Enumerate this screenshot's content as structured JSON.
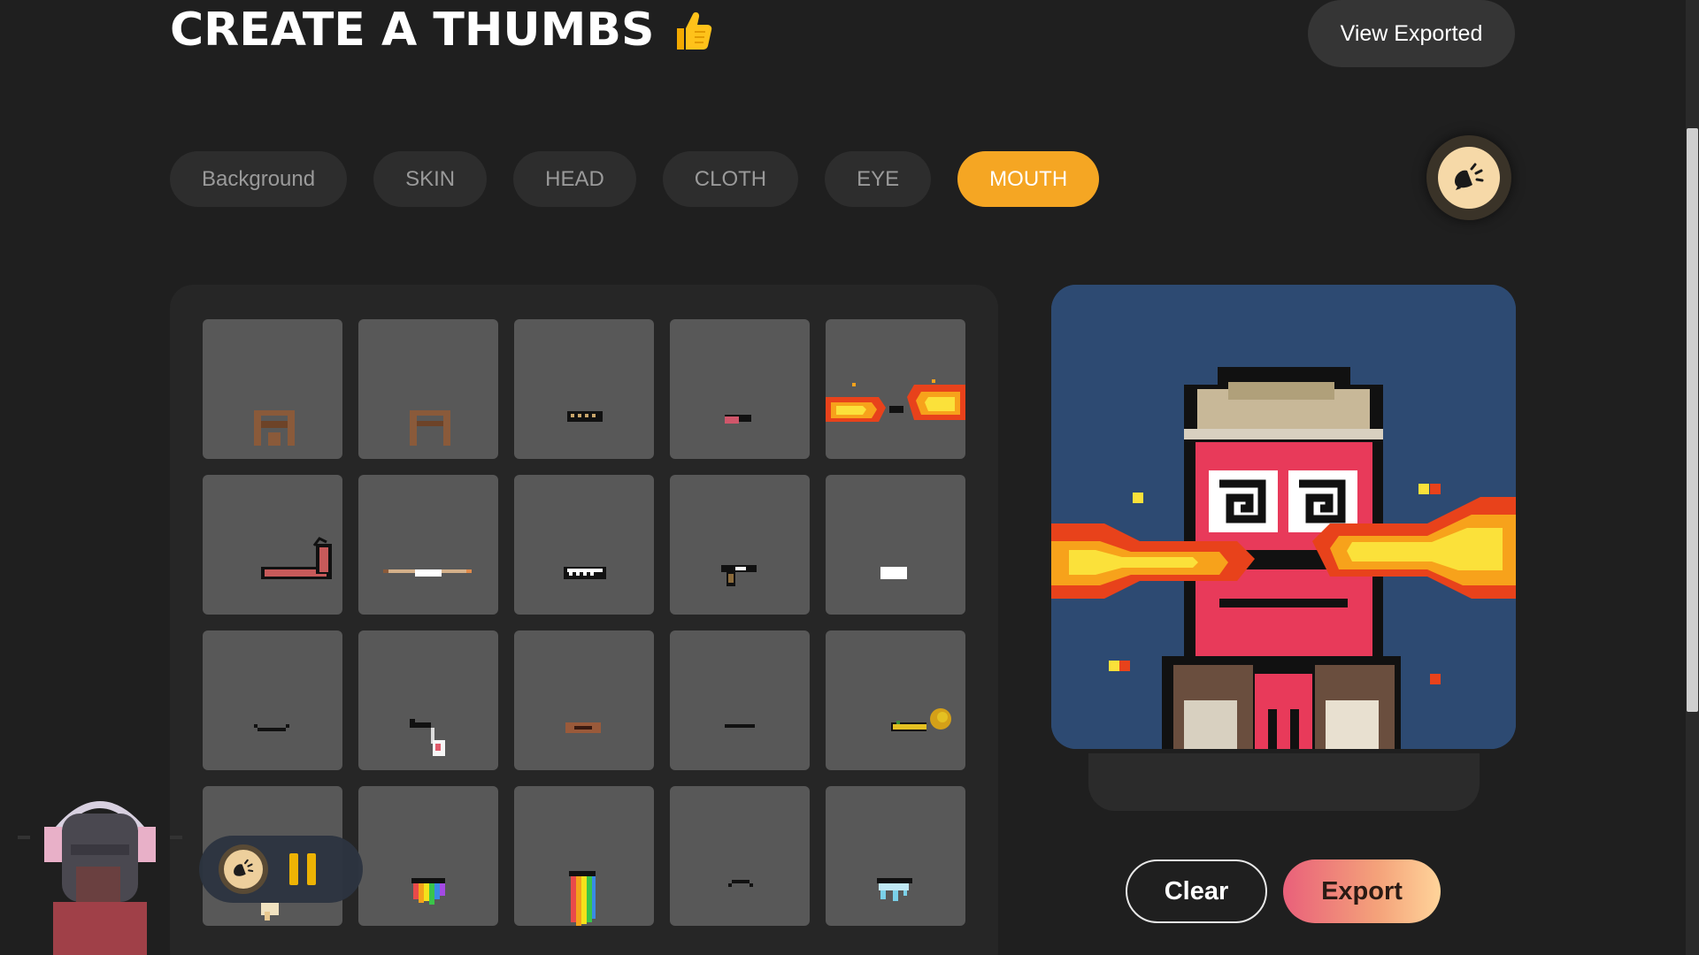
{
  "header": {
    "title": "CREATE A THUMBS",
    "view_exported_label": "View Exported"
  },
  "tabs": [
    {
      "label": "Background",
      "active": false
    },
    {
      "label": "SKIN",
      "active": false
    },
    {
      "label": "HEAD",
      "active": false
    },
    {
      "label": "CLOTH",
      "active": false
    },
    {
      "label": "EYE",
      "active": false
    },
    {
      "label": "MOUTH",
      "active": true
    }
  ],
  "mouth_options": [
    {
      "icon": "brown-beard-mouth"
    },
    {
      "icon": "brown-moustache-mouth"
    },
    {
      "icon": "black-teeth-mouth"
    },
    {
      "icon": "small-tongue-mouth"
    },
    {
      "icon": "fire-breath-mouth"
    },
    {
      "icon": "pipe-mouth"
    },
    {
      "icon": "long-cigarette-mouth"
    },
    {
      "icon": "grin-teeth-mouth"
    },
    {
      "icon": "pistol-mouth"
    },
    {
      "icon": "white-gum-mouth"
    },
    {
      "icon": "smile-mouth"
    },
    {
      "icon": "lollipop-mouth"
    },
    {
      "icon": "brown-lips-mouth"
    },
    {
      "icon": "flat-line-mouth"
    },
    {
      "icon": "party-horn-mouth"
    },
    {
      "icon": "beige-drip-mouth"
    },
    {
      "icon": "rainbow-drip-mouth"
    },
    {
      "icon": "rainbow-vomit-mouth"
    },
    {
      "icon": "frown-mouth"
    },
    {
      "icon": "ice-drip-mouth"
    }
  ],
  "actions": {
    "clear_label": "Clear",
    "export_label": "Export"
  },
  "colors": {
    "accent": "#f5a623",
    "tab_bg": "#2d2d2d",
    "preview_bg": "#2d4a72",
    "cell_bg": "#585858"
  },
  "icons": {
    "title_emoji": "thumbs-up-icon",
    "sound": "sound-toggle-icon",
    "music_pause": "pause-icon"
  }
}
